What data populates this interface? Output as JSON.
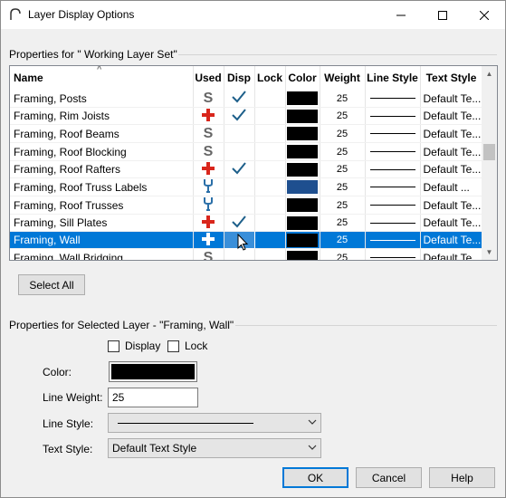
{
  "window": {
    "title": "Layer Display Options"
  },
  "groups": {
    "layer_set_label": "Properties for \" Working Layer Set\"",
    "selected_layer_label": "Properties for Selected Layer - \"Framing, Wall\""
  },
  "table": {
    "columns": [
      "Name",
      "Used",
      "Disp",
      "Lock",
      "Color",
      "Weight",
      "Line Style",
      "Text Style"
    ],
    "rows": [
      {
        "name": "Framing, Posts",
        "used": "s",
        "disp": true,
        "color": "#000000",
        "weight": "25",
        "text_style": "Default Te..."
      },
      {
        "name": "Framing, Rim Joists",
        "used": "plus",
        "disp": true,
        "color": "#000000",
        "weight": "25",
        "text_style": "Default Te..."
      },
      {
        "name": "Framing, Roof Beams",
        "used": "s",
        "disp": false,
        "color": "#000000",
        "weight": "25",
        "text_style": "Default Te..."
      },
      {
        "name": "Framing, Roof Blocking",
        "used": "s",
        "disp": false,
        "color": "#000000",
        "weight": "25",
        "text_style": "Default Te..."
      },
      {
        "name": "Framing, Roof Rafters",
        "used": "plus",
        "disp": true,
        "color": "#000000",
        "weight": "25",
        "text_style": "Default Te..."
      },
      {
        "name": "Framing, Roof Truss Labels",
        "used": "wrench",
        "disp": false,
        "color": "#1e4f8f",
        "weight": "25",
        "text_style": "Default ..."
      },
      {
        "name": "Framing, Roof Trusses",
        "used": "wrench",
        "disp": false,
        "color": "#000000",
        "weight": "25",
        "text_style": "Default Te..."
      },
      {
        "name": "Framing, Sill Plates",
        "used": "plus",
        "disp": true,
        "color": "#000000",
        "weight": "25",
        "text_style": "Default Te..."
      },
      {
        "name": "Framing, Wall",
        "used": "plus",
        "disp": false,
        "color": "#000000",
        "weight": "25",
        "text_style": "Default Te...",
        "selected": true
      },
      {
        "name": "Framing, Wall Bridging",
        "used": "s",
        "disp": false,
        "color": "#000000",
        "weight": "25",
        "text_style": "Default Te..."
      }
    ]
  },
  "buttons": {
    "select_all": "Select All",
    "ok": "OK",
    "cancel": "Cancel",
    "help": "Help"
  },
  "selected_layer": {
    "display_label": "Display",
    "lock_label": "Lock",
    "color_label": "Color:",
    "color_value": "#000000",
    "line_weight_label": "Line Weight:",
    "line_weight_value": "25",
    "line_style_label": "Line Style:",
    "text_style_label": "Text Style:",
    "text_style_value": "Default Text Style"
  },
  "colors": {
    "accent": "#0078d7",
    "used_s": "#666666",
    "used_plus": "#d9261c",
    "used_wrench": "#2a6fa8",
    "check": "#1d5f8a"
  }
}
